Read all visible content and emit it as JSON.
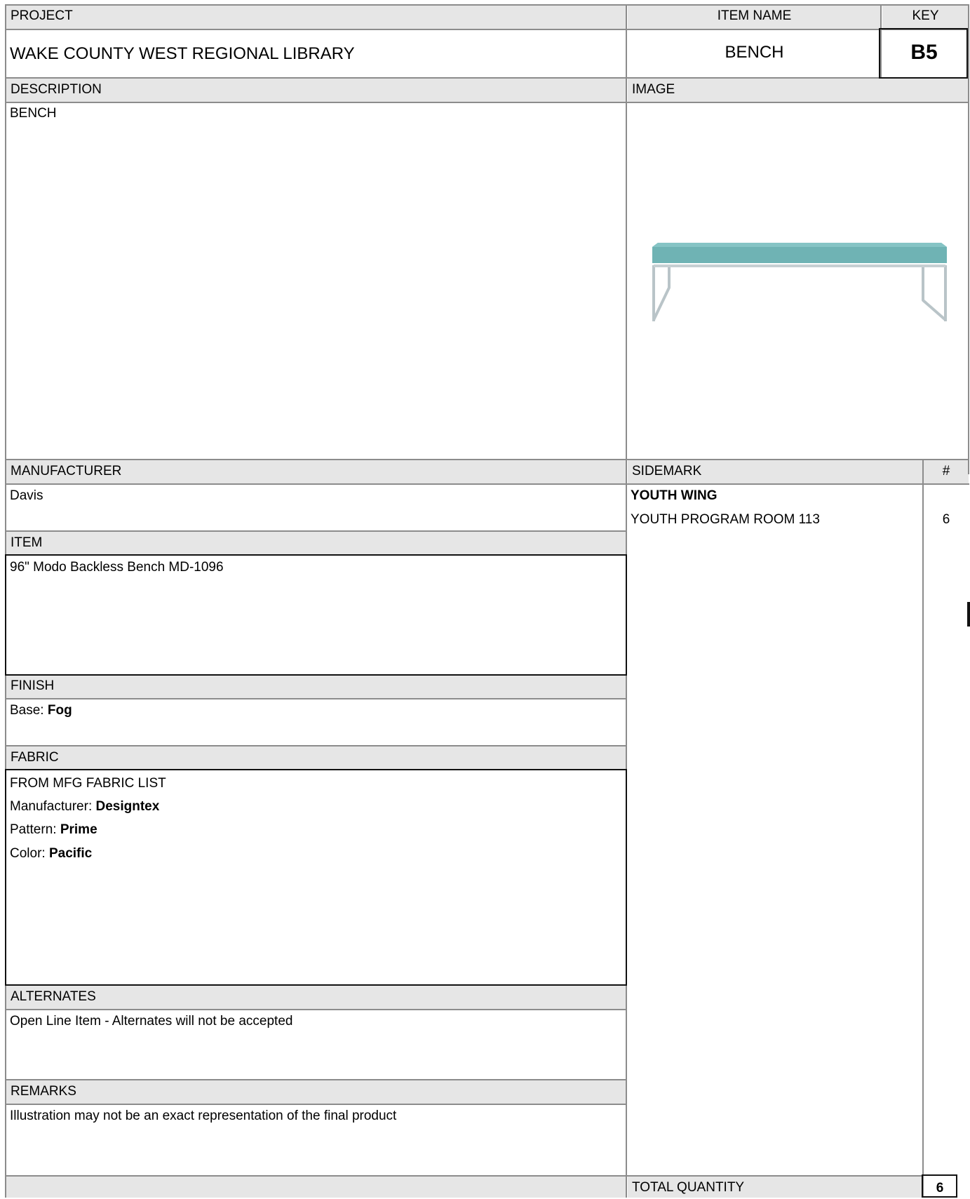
{
  "headers": {
    "project": "PROJECT",
    "item_name": "ITEM NAME",
    "key": "KEY",
    "description": "DESCRIPTION",
    "image": "IMAGE",
    "manufacturer": "MANUFACTURER",
    "sidemark": "SIDEMARK",
    "qty_symbol": "#",
    "item": "ITEM",
    "finish": "FINISH",
    "fabric": "FABRIC",
    "alternates": "ALTERNATES",
    "remarks": "REMARKS",
    "total_quantity": "TOTAL QUANTITY"
  },
  "project": "WAKE COUNTY WEST REGIONAL LIBRARY",
  "item_name": "BENCH",
  "key": "B5",
  "description": "BENCH",
  "manufacturer": "Davis",
  "item": "96\" Modo Backless Bench MD-1096",
  "finish": {
    "label": "Base: ",
    "value": "Fog"
  },
  "fabric": {
    "source": "FROM MFG FABRIC LIST",
    "manufacturer_label": "Manufacturer: ",
    "manufacturer": "Designtex",
    "pattern_label": "Pattern: ",
    "pattern": "Prime",
    "color_label": "Color: ",
    "color": "Pacific"
  },
  "alternates": "Open Line Item - Alternates will not be accepted",
  "remarks": "Illustration may not be an exact representation of the final product",
  "sidemark": {
    "group": "YOUTH WING",
    "rows": [
      {
        "location": "YOUTH PROGRAM ROOM 113",
        "qty": "6"
      }
    ]
  },
  "total_quantity": "6",
  "image": {
    "icon": "bench-icon",
    "seat_color": "#6fb3b4",
    "frame_color": "#b9c4c8"
  }
}
